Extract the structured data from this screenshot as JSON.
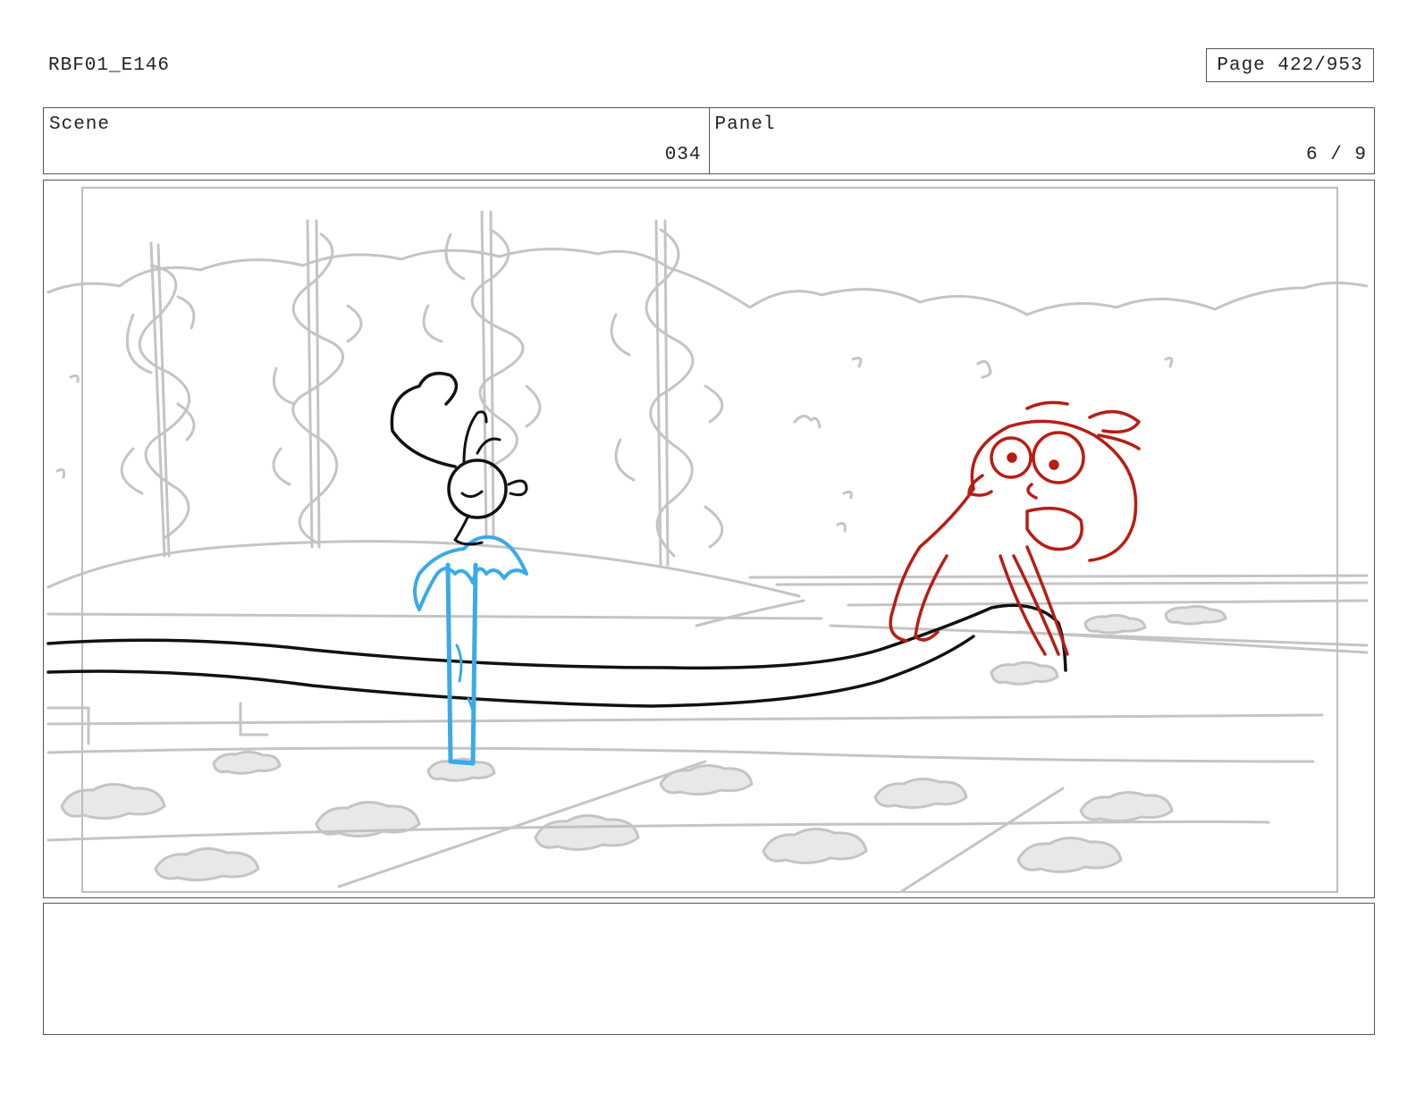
{
  "document": {
    "id": "RBF01_E146",
    "page_label": "Page 422/953"
  },
  "scene": {
    "label": "Scene",
    "value": "034"
  },
  "panel": {
    "label": "Panel",
    "value": "6 / 9"
  },
  "notes": {
    "text": ""
  },
  "colors": {
    "background_sketch": "#c4c4c4",
    "rope": "#111111",
    "blue_character": "#3aaae8",
    "red_character": "#b81d14",
    "border": "#555555"
  },
  "drawing": {
    "content": "storyboard-sketch",
    "elements": [
      "vine-trees",
      "bushes",
      "rope",
      "blue-character",
      "red-character",
      "ground-flowers"
    ]
  }
}
